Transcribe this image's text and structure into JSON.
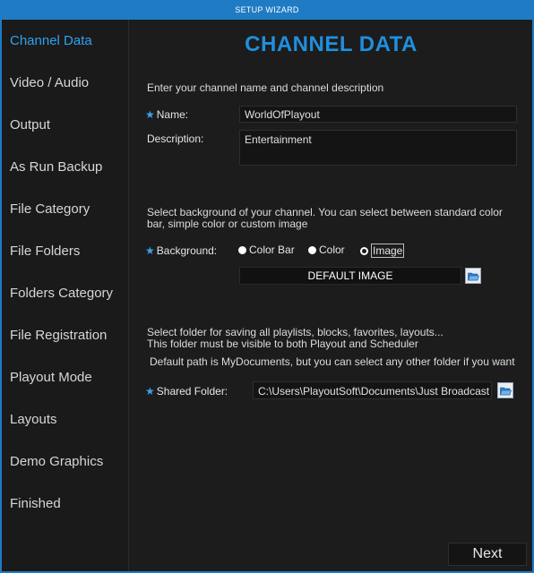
{
  "window": {
    "title": "SETUP WIZARD"
  },
  "sidebar": {
    "items": [
      {
        "label": "Channel Data",
        "active": true
      },
      {
        "label": "Video / Audio"
      },
      {
        "label": "Output"
      },
      {
        "label": "As Run Backup"
      },
      {
        "label": "File Category"
      },
      {
        "label": "File Folders"
      },
      {
        "label": "Folders Category"
      },
      {
        "label": "File Registration"
      },
      {
        "label": "Playout Mode"
      },
      {
        "label": "Layouts"
      },
      {
        "label": "Demo Graphics"
      },
      {
        "label": "Finished"
      }
    ]
  },
  "main": {
    "title": "CHANNEL DATA",
    "intro": "Enter your channel name and channel description",
    "name_label": "Name:",
    "name_value": "WorldOfPlayout",
    "description_label": "Description:",
    "description_value": "Entertainment",
    "background_info_line1": "Select background of your channel. You can select between standard color",
    "background_info_line2": "bar, simple color or custom image",
    "background_label": "Background:",
    "background_options": [
      "Color Bar",
      "Color",
      "Image"
    ],
    "background_selected": "Image",
    "default_image_label": "DEFAULT IMAGE",
    "folder_info_line1": "Select folder for saving all playlists, blocks, favorites, layouts...",
    "folder_info_line2": "This folder must be visible to both Playout and Scheduler",
    "folder_info_line3": "Default path is MyDocuments, but you can select any other folder if you want",
    "shared_folder_label": "Shared Folder:",
    "shared_folder_value": "C:\\Users\\PlayoutSoft\\Documents\\Just Broadcast S",
    "next_label": "Next"
  },
  "colors": {
    "accent": "#1f7bc4",
    "title_blue": "#1f8fe0",
    "active_nav": "#2ea3f2",
    "background": "#1c1c1c"
  }
}
